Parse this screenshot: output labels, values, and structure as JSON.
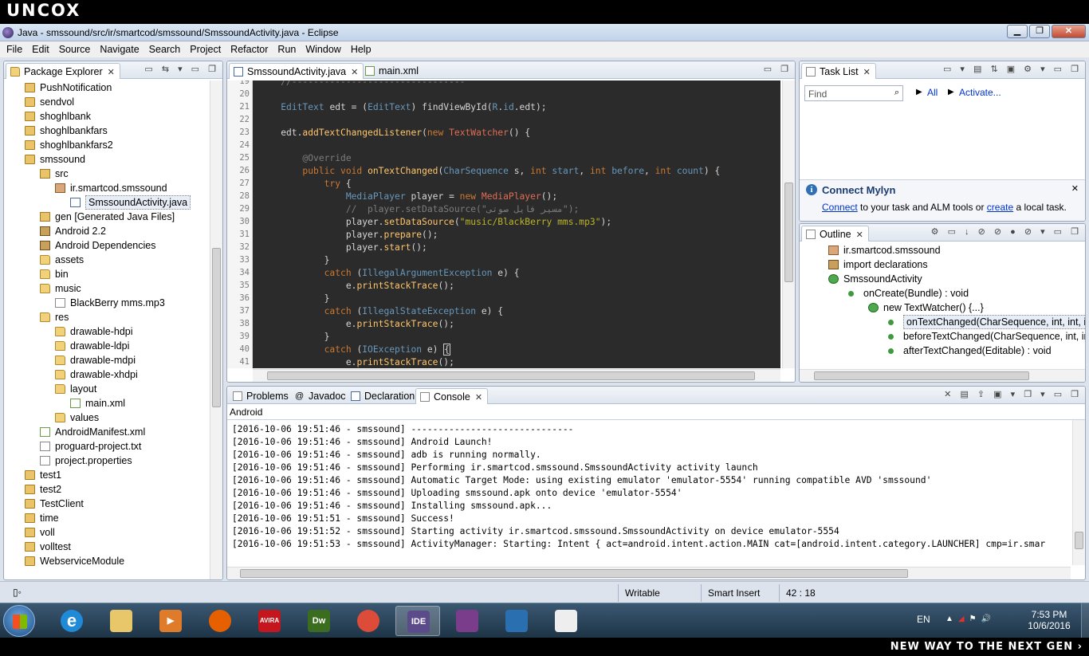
{
  "watermark_top": "UNCOX",
  "watermark_bottom": "NEW WAY TO THE NEXT GEN ›",
  "window": {
    "title": "Java - smssound/src/ir/smartcod/smssound/SmssoundActivity.java - Eclipse",
    "min": "▁",
    "max": "❐",
    "close": "✕"
  },
  "menu": [
    "File",
    "Edit",
    "Source",
    "Navigate",
    "Search",
    "Project",
    "Refactor",
    "Run",
    "Window",
    "Help"
  ],
  "package_explorer": {
    "tab": "Package Explorer",
    "items": [
      {
        "label": "PushNotification",
        "icon": "project",
        "indent": 0
      },
      {
        "label": "sendvol",
        "icon": "project",
        "indent": 0
      },
      {
        "label": "shoghlbank",
        "icon": "project",
        "indent": 0
      },
      {
        "label": "shoghlbankfars",
        "icon": "project",
        "indent": 0
      },
      {
        "label": "shoghlbankfars2",
        "icon": "project",
        "indent": 0
      },
      {
        "label": "smssound",
        "icon": "project",
        "indent": 0
      },
      {
        "label": "src",
        "icon": "src-folder",
        "indent": 1
      },
      {
        "label": "ir.smartcod.smssound",
        "icon": "package",
        "indent": 2
      },
      {
        "label": "SmssoundActivity.java",
        "icon": "java-file",
        "indent": 3,
        "selected": true
      },
      {
        "label": "gen [Generated Java Files]",
        "icon": "src-folder",
        "indent": 1
      },
      {
        "label": "Android 2.2",
        "icon": "library",
        "indent": 1
      },
      {
        "label": "Android Dependencies",
        "icon": "library",
        "indent": 1
      },
      {
        "label": "assets",
        "icon": "folder",
        "indent": 1
      },
      {
        "label": "bin",
        "icon": "folder",
        "indent": 1
      },
      {
        "label": "music",
        "icon": "folder",
        "indent": 1
      },
      {
        "label": "BlackBerry mms.mp3",
        "icon": "file",
        "indent": 2
      },
      {
        "label": "res",
        "icon": "folder",
        "indent": 1
      },
      {
        "label": "drawable-hdpi",
        "icon": "folder",
        "indent": 2
      },
      {
        "label": "drawable-ldpi",
        "icon": "folder",
        "indent": 2
      },
      {
        "label": "drawable-mdpi",
        "icon": "folder",
        "indent": 2
      },
      {
        "label": "drawable-xhdpi",
        "icon": "folder",
        "indent": 2
      },
      {
        "label": "layout",
        "icon": "folder",
        "indent": 2
      },
      {
        "label": "main.xml",
        "icon": "xml-file",
        "indent": 3
      },
      {
        "label": "values",
        "icon": "folder",
        "indent": 2
      },
      {
        "label": "AndroidManifest.xml",
        "icon": "xml-file",
        "indent": 1
      },
      {
        "label": "proguard-project.txt",
        "icon": "file",
        "indent": 1
      },
      {
        "label": "project.properties",
        "icon": "file",
        "indent": 1
      },
      {
        "label": "test1",
        "icon": "project",
        "indent": 0
      },
      {
        "label": "test2",
        "icon": "project",
        "indent": 0
      },
      {
        "label": "TestClient",
        "icon": "project",
        "indent": 0
      },
      {
        "label": "time",
        "icon": "project",
        "indent": 0
      },
      {
        "label": "voll",
        "icon": "project",
        "indent": 0
      },
      {
        "label": "volltest",
        "icon": "project",
        "indent": 0
      },
      {
        "label": "WebserviceModule",
        "icon": "project",
        "indent": 0
      }
    ]
  },
  "editor": {
    "tabs": [
      "SmssoundActivity.java",
      "main.xml"
    ],
    "lines": [
      {
        "n": "19",
        "html": "    <span class=\"c\">//--------------------------------</span>"
      },
      {
        "n": "20",
        "html": ""
      },
      {
        "n": "21",
        "html": "    <span class=\"t\">EditText</span> edt = (<span class=\"t\">EditText</span>) findViewById(<span class=\"t\">R</span>.<span class=\"t\">id</span>.edt);"
      },
      {
        "n": "22",
        "html": ""
      },
      {
        "n": "23",
        "html": "    edt.<span class=\"m\">addTextChangedListener</span>(<span class=\"k\">new</span> <span class=\"f\">TextWatcher</span>() {"
      },
      {
        "n": "24",
        "html": ""
      },
      {
        "n": "25",
        "html": "        <span class=\"c\">@Override</span>"
      },
      {
        "n": "26",
        "html": "        <span class=\"k\">public void</span> <span class=\"m\">onTextChanged</span>(<span class=\"t\">CharSequence</span> s, <span class=\"k\">int</span> <span class=\"t\">start</span>, <span class=\"k\">int</span> <span class=\"t\">before</span>, <span class=\"k\">int</span> <span class=\"t\">count</span>) {"
      },
      {
        "n": "27",
        "html": "            <span class=\"k\">try</span> {"
      },
      {
        "n": "28",
        "html": "                <span class=\"t\">MediaPlayer</span> player = <span class=\"k\">new</span> <span class=\"f\">MediaPlayer</span>();"
      },
      {
        "n": "29",
        "html": "                <span class=\"c\">//  player.setDataSource(\"مسیر فایل صوتی\");</span>"
      },
      {
        "n": "30",
        "html": "                player.<span class=\"m\">setDataSource</span>(<span class=\"a\">\"music/BlackBerry mms.mp3\"</span>);"
      },
      {
        "n": "31",
        "html": "                player.<span class=\"m\">prepare</span>();"
      },
      {
        "n": "32",
        "html": "                player.<span class=\"m\">start</span>();"
      },
      {
        "n": "33",
        "html": "            }"
      },
      {
        "n": "34",
        "html": "            <span class=\"k\">catch</span> (<span class=\"t\">IllegalArgumentException</span> e) {"
      },
      {
        "n": "35",
        "html": "                e.<span class=\"m\">printStackTrace</span>();"
      },
      {
        "n": "36",
        "html": "            }"
      },
      {
        "n": "37",
        "html": "            <span class=\"k\">catch</span> (<span class=\"t\">IllegalStateException</span> e) {"
      },
      {
        "n": "38",
        "html": "                e.<span class=\"m\">printStackTrace</span>();"
      },
      {
        "n": "39",
        "html": "            }"
      },
      {
        "n": "40",
        "html": "            <span class=\"k\">catch</span> (<span class=\"t\">IOException</span> e) <span style=\"border:1px solid #ccc\">{</span>"
      },
      {
        "n": "41",
        "html": "                e.<span class=\"m\">printStackTrace</span>();"
      }
    ]
  },
  "task_list": {
    "tab": "Task List",
    "find_placeholder": "Find",
    "all": "All",
    "activate": "Activate...",
    "mylyn_title": "Connect Mylyn",
    "mylyn_connect": "Connect",
    "mylyn_mid": " to your task and ALM tools or ",
    "mylyn_create": "create",
    "mylyn_end": " a local task."
  },
  "outline": {
    "tab": "Outline",
    "items": [
      {
        "label": "ir.smartcod.smssound",
        "icon": "package",
        "indent": 0
      },
      {
        "label": "import declarations",
        "icon": "import",
        "indent": 0
      },
      {
        "label": "SmssoundActivity",
        "icon": "class",
        "indent": 0
      },
      {
        "label": "onCreate(Bundle) : void",
        "icon": "method",
        "indent": 1
      },
      {
        "label": "new TextWatcher() {...}",
        "icon": "class",
        "indent": 2
      },
      {
        "label": "onTextChanged(CharSequence, int, int, int",
        "icon": "method",
        "indent": 3,
        "selected": true
      },
      {
        "label": "beforeTextChanged(CharSequence, int, int",
        "icon": "method",
        "indent": 3
      },
      {
        "label": "afterTextChanged(Editable) : void",
        "icon": "method",
        "indent": 3
      }
    ]
  },
  "console": {
    "tabs": [
      "Problems",
      "Javadoc",
      "Declaration",
      "Console"
    ],
    "header": "Android",
    "lines": [
      "[2016-10-06 19:51:46 - smssound] ------------------------------",
      "[2016-10-06 19:51:46 - smssound] Android Launch!",
      "[2016-10-06 19:51:46 - smssound] adb is running normally.",
      "[2016-10-06 19:51:46 - smssound] Performing ir.smartcod.smssound.SmssoundActivity activity launch",
      "[2016-10-06 19:51:46 - smssound] Automatic Target Mode: using existing emulator 'emulator-5554' running compatible AVD 'smssound'",
      "[2016-10-06 19:51:46 - smssound] Uploading smssound.apk onto device 'emulator-5554'",
      "[2016-10-06 19:51:46 - smssound] Installing smssound.apk...",
      "[2016-10-06 19:51:51 - smssound] Success!",
      "[2016-10-06 19:51:52 - smssound] Starting activity ir.smartcod.smssound.SmssoundActivity on device emulator-5554",
      "[2016-10-06 19:51:53 - smssound] ActivityManager: Starting: Intent { act=android.intent.action.MAIN cat=[android.intent.category.LAUNCHER] cmp=ir.smar"
    ]
  },
  "status": {
    "writable": "Writable",
    "insert": "Smart Insert",
    "position": "42 : 18"
  },
  "taskbar": {
    "apps": [
      {
        "name": "internet-explorer",
        "glyph": "e",
        "color": "#1f8ad8"
      },
      {
        "name": "file-explorer",
        "glyph": "",
        "color": "#e8c66a"
      },
      {
        "name": "media-player",
        "glyph": "▶",
        "color": "#e07b2a"
      },
      {
        "name": "firefox",
        "glyph": "",
        "color": "#e66000"
      },
      {
        "name": "avira",
        "glyph": "AVIRA",
        "color": "#c4161c"
      },
      {
        "name": "dreamweaver",
        "glyph": "Dw",
        "color": "#3b6d1f"
      },
      {
        "name": "chrome",
        "glyph": "",
        "color": "#dd4b39"
      },
      {
        "name": "eclipse-java-ee",
        "glyph": "IDE",
        "color": "#5b4b8a",
        "active": true
      },
      {
        "name": "winrar",
        "glyph": "",
        "color": "#7a3d8c"
      },
      {
        "name": "eclipse",
        "glyph": "",
        "color": "#2a6fb0"
      },
      {
        "name": "notepad",
        "glyph": "",
        "color": "#eeeeee"
      }
    ],
    "lang": "EN",
    "time": "7:53 PM",
    "date": "10/6/2016"
  }
}
